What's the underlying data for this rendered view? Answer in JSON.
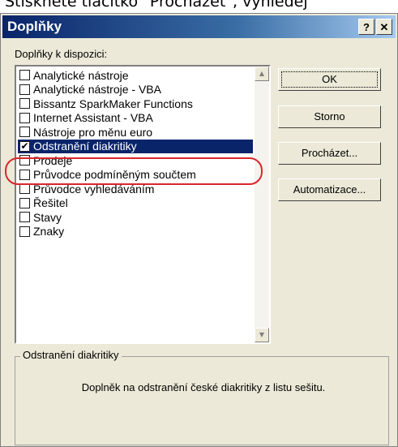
{
  "caption": "Stiskněte tlačítko \"Procházet\", vyhledej",
  "window": {
    "title": "Doplňky",
    "help_label": "?",
    "close_label": "✕"
  },
  "list": {
    "label": "Doplňky k dispozici:",
    "items": [
      {
        "label": "Analytické nástroje",
        "checked": false
      },
      {
        "label": "Analytické nástroje - VBA",
        "checked": false
      },
      {
        "label": "Bissantz SparkMaker Functions",
        "checked": false
      },
      {
        "label": "Internet Assistant - VBA",
        "checked": false
      },
      {
        "label": "Nástroje pro měnu euro",
        "checked": false
      },
      {
        "label": "Odstranění diakritiky",
        "checked": true,
        "selected": true
      },
      {
        "label": "Prodeje",
        "checked": false
      },
      {
        "label": "Průvodce podmíněným součtem",
        "checked": false
      },
      {
        "label": "Průvodce vyhledáváním",
        "checked": false
      },
      {
        "label": "Řešitel",
        "checked": false
      },
      {
        "label": "Stavy",
        "checked": false
      },
      {
        "label": "Znaky",
        "checked": false
      }
    ]
  },
  "buttons": {
    "ok": "OK",
    "cancel": "Storno",
    "browse": "Procházet...",
    "automation": "Automatizace..."
  },
  "description": {
    "title": "Odstranění diakritiky",
    "text": "Doplněk na odstranění české diakritiky z listu sešitu."
  },
  "colors": {
    "selection": "#0a246a",
    "highlight_ellipse": "#d9262b",
    "dialog_face": "#ece9d8"
  }
}
